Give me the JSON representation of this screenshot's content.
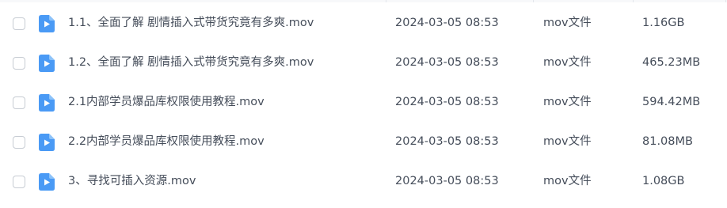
{
  "files": [
    {
      "name": "1.1、全面了解 剧情插入式带货究竟有多爽.mov",
      "modified": "2024-03-05 08:53",
      "type": "mov文件",
      "size": "1.16GB"
    },
    {
      "name": "1.2、全面了解 剧情插入式带货究竟有多爽.mov",
      "modified": "2024-03-05 08:53",
      "type": "mov文件",
      "size": "465.23MB"
    },
    {
      "name": "2.1内部学员爆品库权限使用教程.mov",
      "modified": "2024-03-05 08:53",
      "type": "mov文件",
      "size": "594.42MB"
    },
    {
      "name": "2.2内部学员爆品库权限使用教程.mov",
      "modified": "2024-03-05 08:53",
      "type": "mov文件",
      "size": "81.08MB"
    },
    {
      "name": "3、寻找可插入资源.mov",
      "modified": "2024-03-05 08:53",
      "type": "mov文件",
      "size": "1.08GB"
    }
  ],
  "icon": {
    "name": "video-file-icon",
    "color": "#4a9af5"
  },
  "colors": {
    "text": "#454d5a",
    "checkbox_border": "#c7ccd3"
  }
}
